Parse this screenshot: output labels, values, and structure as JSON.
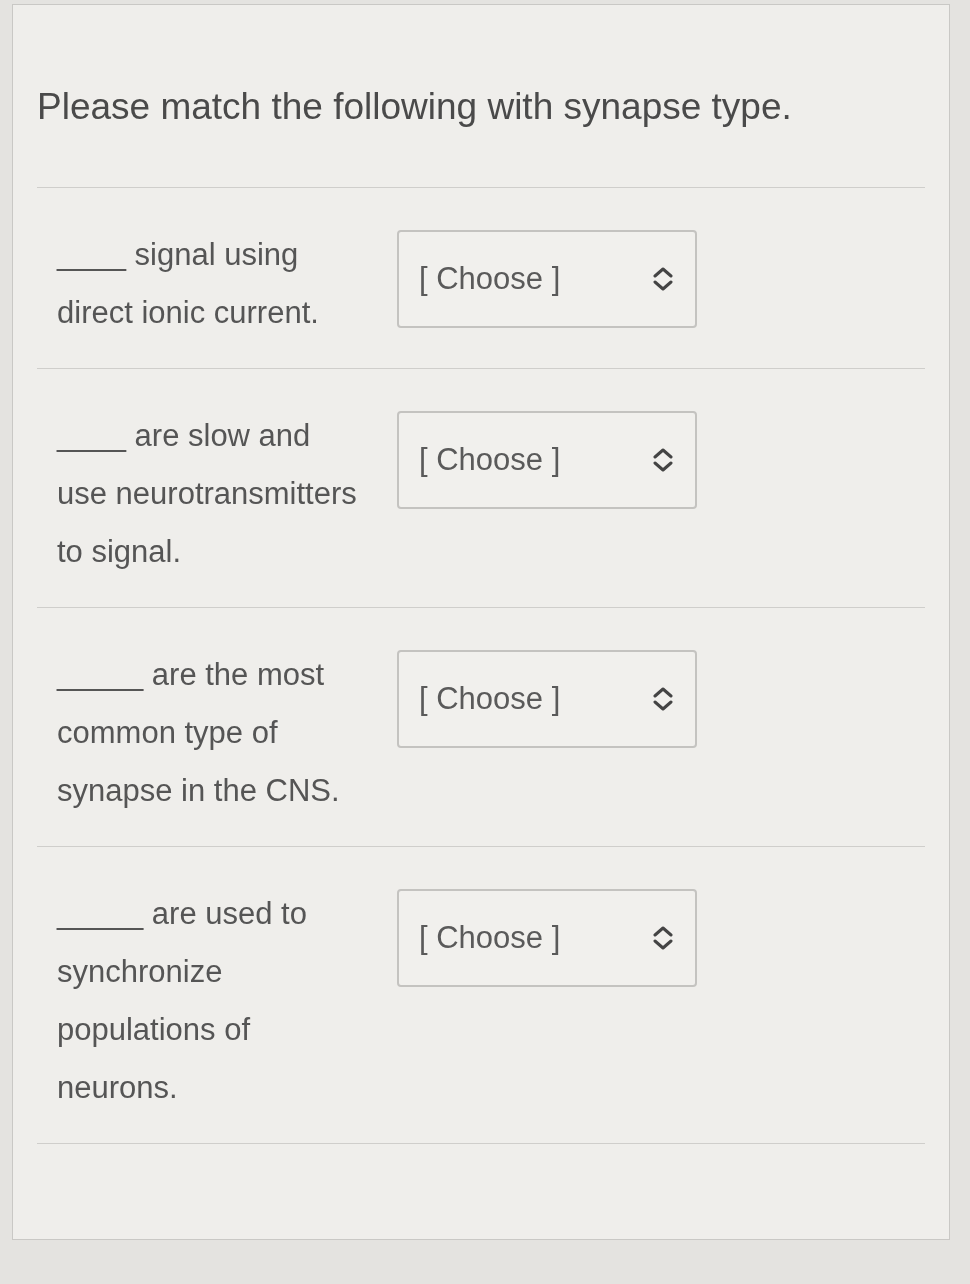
{
  "question": {
    "title": "Please match the following with synapse type."
  },
  "items": [
    {
      "prompt": "____ signal using direct ionic current.",
      "dropdown": {
        "text": "[ Choose ]"
      }
    },
    {
      "prompt": "____ are slow and use neurotransmitters to signal.",
      "dropdown": {
        "text": "[ Choose ]"
      }
    },
    {
      "prompt": "_____ are the most common type of synapse in the CNS.",
      "dropdown": {
        "text": "[ Choose ]"
      }
    },
    {
      "prompt": "_____ are used to synchronize populations of neurons.",
      "dropdown": {
        "text": "[ Choose ]"
      }
    }
  ]
}
